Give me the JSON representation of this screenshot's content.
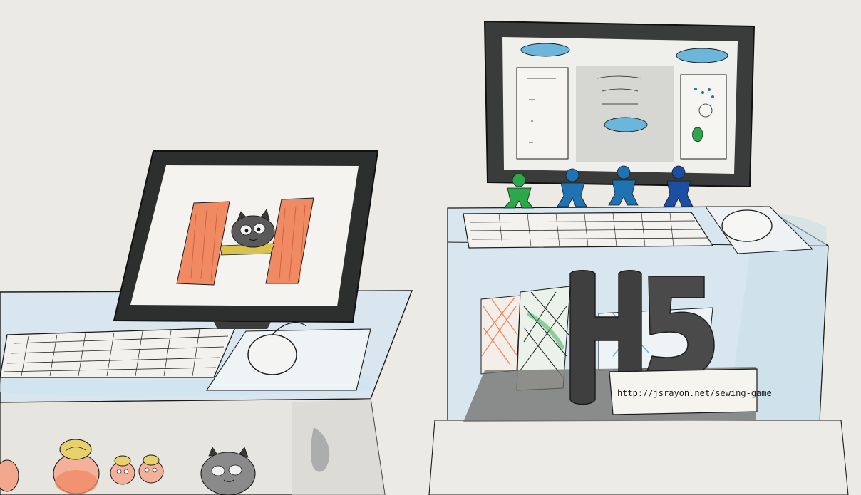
{
  "sketch": {
    "sign_text": "http://jsrayon.net/sewing-game",
    "logo_text": "H5"
  },
  "colors": {
    "paper": "#eeebe6",
    "ink": "#1a1a1a",
    "bezel_left": "#2c2f2e",
    "bezel_right": "#3a3c3c",
    "desk_blue": "#cfe3ef",
    "orange": "#f08a63",
    "yellow": "#d9c24b",
    "green": "#2ca84a",
    "blue": "#1f73b2",
    "blue_dark": "#1a4fa3",
    "logo_gray": "#3f3f3f"
  }
}
